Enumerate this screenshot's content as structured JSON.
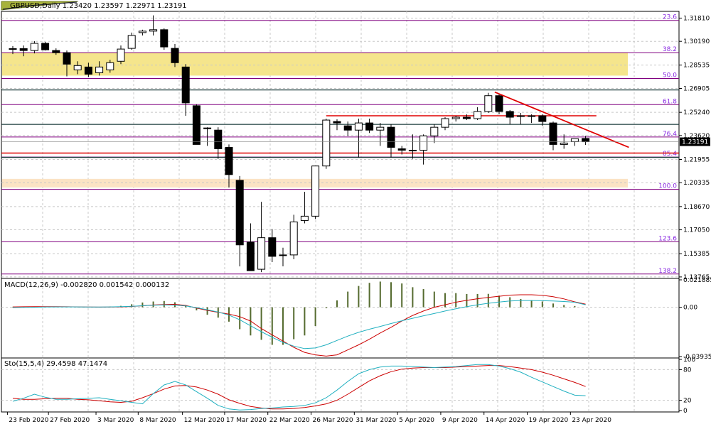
{
  "header": {
    "title": "GBPUSD,Daily",
    "ohlc": "1.23420 1.23597 1.22971 1.23191",
    "macd_label": "MACD(12,26,9) -0.002820 0.001542 0.000132",
    "stoch_label": "Sto(15,5,4) 29.4598 47.1474"
  },
  "colors": {
    "bull_fill": "#ffffff",
    "bear_fill": "#000000",
    "grid": "#c8c8c8",
    "fib_line": "#800080",
    "fib_text": "#8a2be2",
    "zone_yellow": "#f5e58c",
    "zone_peach": "#fbe3c4",
    "resistance": "#e00000",
    "level_dark": "#1f3f3f",
    "macd_hist": "#556b2f",
    "macd_signal": "#cc0000",
    "macd_main": "#20b0c0",
    "stoch_main": "#20b0c0",
    "stoch_signal": "#cc0000",
    "price_box": "#000000"
  },
  "chart_data": [
    {
      "type": "candlestick",
      "symbol": "GBPUSD",
      "timeframe": "Daily",
      "ylim": [
        1.1376,
        1.3218
      ],
      "y_ticks": [
        "1.31810",
        "1.30190",
        "1.28535",
        "1.26905",
        "1.25240",
        "1.23620",
        "1.21955",
        "1.20335",
        "1.18670",
        "1.17050",
        "1.15385",
        "1.13765"
      ],
      "current_price": "1.23191",
      "candles": [
        {
          "o": 1.2968,
          "h": 1.2986,
          "l": 1.293,
          "c": 1.2966
        },
        {
          "o": 1.2968,
          "h": 1.299,
          "l": 1.2915,
          "c": 1.2955
        },
        {
          "o": 1.2955,
          "h": 1.302,
          "l": 1.2935,
          "c": 1.3005
        },
        {
          "o": 1.3005,
          "h": 1.3015,
          "l": 1.2955,
          "c": 1.296
        },
        {
          "o": 1.2955,
          "h": 1.297,
          "l": 1.2925,
          "c": 1.294
        },
        {
          "o": 1.294,
          "h": 1.2955,
          "l": 1.2775,
          "c": 1.286
        },
        {
          "o": 1.282,
          "h": 1.288,
          "l": 1.279,
          "c": 1.285
        },
        {
          "o": 1.284,
          "h": 1.287,
          "l": 1.277,
          "c": 1.279
        },
        {
          "o": 1.28,
          "h": 1.288,
          "l": 1.278,
          "c": 1.284
        },
        {
          "o": 1.282,
          "h": 1.289,
          "l": 1.28,
          "c": 1.287
        },
        {
          "o": 1.288,
          "h": 1.299,
          "l": 1.286,
          "c": 1.2965
        },
        {
          "o": 1.297,
          "h": 1.308,
          "l": 1.296,
          "c": 1.306
        },
        {
          "o": 1.308,
          "h": 1.31,
          "l": 1.306,
          "c": 1.309
        },
        {
          "o": 1.309,
          "h": 1.32,
          "l": 1.306,
          "c": 1.31
        },
        {
          "o": 1.31,
          "h": 1.311,
          "l": 1.296,
          "c": 1.298
        },
        {
          "o": 1.297,
          "h": 1.3,
          "l": 1.284,
          "c": 1.287
        },
        {
          "o": 1.284,
          "h": 1.286,
          "l": 1.25,
          "c": 1.259
        },
        {
          "o": 1.257,
          "h": 1.258,
          "l": 1.23,
          "c": 1.23
        },
        {
          "o": 1.2415,
          "h": 1.242,
          "l": 1.229,
          "c": 1.241
        },
        {
          "o": 1.24,
          "h": 1.242,
          "l": 1.22,
          "c": 1.227
        },
        {
          "o": 1.228,
          "h": 1.23,
          "l": 1.2,
          "c": 1.209
        },
        {
          "o": 1.205,
          "h": 1.208,
          "l": 1.145,
          "c": 1.16
        },
        {
          "o": 1.162,
          "h": 1.175,
          "l": 1.142,
          "c": 1.142
        },
        {
          "o": 1.143,
          "h": 1.19,
          "l": 1.141,
          "c": 1.165
        },
        {
          "o": 1.165,
          "h": 1.171,
          "l": 1.148,
          "c": 1.152
        },
        {
          "o": 1.153,
          "h": 1.158,
          "l": 1.145,
          "c": 1.153
        },
        {
          "o": 1.153,
          "h": 1.181,
          "l": 1.15,
          "c": 1.176
        },
        {
          "o": 1.177,
          "h": 1.197,
          "l": 1.175,
          "c": 1.18
        },
        {
          "o": 1.18,
          "h": 1.204,
          "l": 1.178,
          "c": 1.215
        },
        {
          "o": 1.215,
          "h": 1.248,
          "l": 1.213,
          "c": 1.247
        },
        {
          "o": 1.246,
          "h": 1.2475,
          "l": 1.24,
          "c": 1.245
        },
        {
          "o": 1.243,
          "h": 1.246,
          "l": 1.236,
          "c": 1.24
        },
        {
          "o": 1.24,
          "h": 1.248,
          "l": 1.221,
          "c": 1.245
        },
        {
          "o": 1.245,
          "h": 1.248,
          "l": 1.238,
          "c": 1.24
        },
        {
          "o": 1.24,
          "h": 1.245,
          "l": 1.229,
          "c": 1.242
        },
        {
          "o": 1.242,
          "h": 1.244,
          "l": 1.221,
          "c": 1.228
        },
        {
          "o": 1.227,
          "h": 1.229,
          "l": 1.223,
          "c": 1.226
        },
        {
          "o": 1.226,
          "h": 1.237,
          "l": 1.22,
          "c": 1.226
        },
        {
          "o": 1.226,
          "h": 1.237,
          "l": 1.216,
          "c": 1.236
        },
        {
          "o": 1.236,
          "h": 1.244,
          "l": 1.231,
          "c": 1.242
        },
        {
          "o": 1.242,
          "h": 1.249,
          "l": 1.24,
          "c": 1.248
        },
        {
          "o": 1.248,
          "h": 1.25,
          "l": 1.246,
          "c": 1.249
        },
        {
          "o": 1.249,
          "h": 1.251,
          "l": 1.247,
          "c": 1.248
        },
        {
          "o": 1.248,
          "h": 1.256,
          "l": 1.247,
          "c": 1.253
        },
        {
          "o": 1.253,
          "h": 1.266,
          "l": 1.252,
          "c": 1.264
        },
        {
          "o": 1.264,
          "h": 1.265,
          "l": 1.251,
          "c": 1.253
        },
        {
          "o": 1.253,
          "h": 1.254,
          "l": 1.244,
          "c": 1.249
        },
        {
          "o": 1.25,
          "h": 1.252,
          "l": 1.244,
          "c": 1.25
        },
        {
          "o": 1.25,
          "h": 1.251,
          "l": 1.245,
          "c": 1.25
        },
        {
          "o": 1.25,
          "h": 1.251,
          "l": 1.243,
          "c": 1.246
        },
        {
          "o": 1.245,
          "h": 1.246,
          "l": 1.226,
          "c": 1.23
        },
        {
          "o": 1.23,
          "h": 1.237,
          "l": 1.227,
          "c": 1.231
        },
        {
          "o": 1.232,
          "h": 1.234,
          "l": 1.229,
          "c": 1.234
        },
        {
          "o": 1.2342,
          "h": 1.236,
          "l": 1.2297,
          "c": 1.2319
        }
      ],
      "fib_levels": [
        {
          "label": "23.6",
          "value": 1.3165
        },
        {
          "label": "38.2",
          "value": 1.294
        },
        {
          "label": "50.0",
          "value": 1.276
        },
        {
          "label": "61.8",
          "value": 1.2578
        },
        {
          "label": "76.4",
          "value": 1.2352
        },
        {
          "label": "85.4",
          "value": 1.2212
        },
        {
          "label": "100.0",
          "value": 1.1987
        },
        {
          "label": "123.6",
          "value": 1.1622
        },
        {
          "label": "138.2",
          "value": 1.1397
        }
      ],
      "zones": [
        {
          "from": 1.278,
          "to": 1.294,
          "color": "yellow"
        },
        {
          "from": 1.2,
          "to": 1.206,
          "color": "peach"
        }
      ],
      "horizontal_levels": [
        {
          "value": 1.268,
          "color": "dark"
        },
        {
          "value": 1.244,
          "color": "dark"
        },
        {
          "value": 1.224,
          "color": "red"
        },
        {
          "value": 1.221,
          "color": "dark"
        }
      ],
      "resistance_segment": {
        "from_index": 29,
        "to_index": 54,
        "value": 1.25
      },
      "trendline": {
        "start": {
          "index": 44.6,
          "value": 1.2665
        },
        "end": {
          "index": 57.0,
          "value": 1.228
        }
      }
    },
    {
      "type": "bar",
      "name": "MACD(12,26,9)",
      "ylim": [
        -0.039351,
        0.021885
      ],
      "y_ticks": [
        "0.021885",
        "0.00",
        "-0.039351"
      ],
      "histogram": [
        0.0004,
        0.0004,
        0.0006,
        0.0006,
        0.0005,
        0.0002,
        0.0002,
        0.0,
        0.0001,
        0.0006,
        0.0011,
        0.0024,
        0.0038,
        0.0046,
        0.005,
        0.004,
        0.0018,
        -0.0025,
        -0.006,
        -0.0083,
        -0.0115,
        -0.0175,
        -0.0225,
        -0.026,
        -0.03,
        -0.03,
        -0.0255,
        -0.0225,
        -0.015,
        -0.0008,
        0.0055,
        0.0125,
        0.017,
        0.0195,
        0.0205,
        0.02,
        0.019,
        0.016,
        0.0145,
        0.0125,
        0.0113,
        0.0113,
        0.0106,
        0.0106,
        0.0107,
        0.0093,
        0.008,
        0.0066,
        0.0056,
        0.0046,
        0.003,
        0.0018,
        0.001,
        0.0
      ],
      "signal_line": [
        0.0003,
        0.0004,
        0.0005,
        0.0005,
        0.0005,
        0.0004,
        0.0003,
        0.0002,
        0.0001,
        0.0002,
        0.0003,
        0.0006,
        0.0012,
        0.0018,
        0.0022,
        0.0023,
        0.0015,
        -0.0007,
        -0.0025,
        -0.004,
        -0.0055,
        -0.0075,
        -0.011,
        -0.017,
        -0.022,
        -0.027,
        -0.032,
        -0.036,
        -0.038,
        -0.039,
        -0.038,
        -0.034,
        -0.03,
        -0.0255,
        -0.0205,
        -0.016,
        -0.011,
        -0.0065,
        -0.003,
        0.0,
        0.002,
        0.004,
        0.0055,
        0.0068,
        0.0078,
        0.0088,
        0.0097,
        0.01,
        0.01,
        0.0095,
        0.0084,
        0.0067,
        0.0043,
        0.0025
      ],
      "main_line": [
        -0.0002,
        -0.0001,
        0.0,
        0.0002,
        0.0003,
        0.0003,
        0.0003,
        0.0002,
        0.0002,
        0.0003,
        0.0005,
        0.0008,
        0.0012,
        0.0016,
        0.0019,
        0.0017,
        0.001,
        -0.0003,
        -0.002,
        -0.0038,
        -0.0063,
        -0.01,
        -0.0148,
        -0.0195,
        -0.024,
        -0.028,
        -0.031,
        -0.033,
        -0.0325,
        -0.03,
        -0.0265,
        -0.023,
        -0.02,
        -0.0175,
        -0.0153,
        -0.013,
        -0.0108,
        -0.0088,
        -0.0068,
        -0.005,
        -0.003,
        -0.0012,
        0.0005,
        0.002,
        0.0032,
        0.0042,
        0.005,
        0.0054,
        0.0054,
        0.0052,
        0.005,
        0.0046,
        0.004,
        0.002
      ]
    },
    {
      "type": "line",
      "name": "Sto(15,5,4)",
      "ylim": [
        0,
        100
      ],
      "y_ticks": [
        "100",
        "80",
        "20",
        "0"
      ],
      "main_line": [
        18,
        24,
        32,
        26,
        22,
        22,
        23,
        24,
        25,
        22,
        19,
        16,
        13,
        33,
        50,
        57,
        50,
        37,
        24,
        10,
        3,
        1,
        2,
        4,
        5,
        7,
        8,
        10,
        15,
        25,
        40,
        57,
        72,
        80,
        85,
        87,
        87,
        86,
        85,
        84,
        85,
        86,
        88,
        90,
        90,
        87,
        82,
        75,
        65,
        56,
        47,
        38,
        30,
        29
      ],
      "signal_line": [
        24,
        22,
        22,
        23,
        24,
        24,
        22,
        21,
        19,
        17,
        16,
        18,
        25,
        33,
        42,
        48,
        49,
        46,
        40,
        32,
        21,
        14,
        8,
        5,
        3,
        3,
        4,
        6,
        9,
        13,
        20,
        32,
        45,
        58,
        68,
        76,
        81,
        83,
        84,
        84,
        84,
        85,
        86,
        87,
        88,
        88,
        86,
        83,
        80,
        75,
        69,
        62,
        55,
        47
      ]
    }
  ],
  "x_axis": {
    "labels": [
      {
        "text": "23 Feb 2020",
        "index": -0.5
      },
      {
        "text": "27 Feb 2020",
        "index": 3.3
      },
      {
        "text": "3 Mar 2020",
        "index": 7.7
      },
      {
        "text": "8 Mar 2020",
        "index": 11.6
      },
      {
        "text": "12 Mar 2020",
        "index": 15.7
      },
      {
        "text": "17 Mar 2020",
        "index": 19.6
      },
      {
        "text": "22 Mar 2020",
        "index": 23.6
      },
      {
        "text": "26 Mar 2020",
        "index": 27.6
      },
      {
        "text": "31 Mar 2020",
        "index": 31.6
      },
      {
        "text": "5 Apr 2020",
        "index": 35.6
      },
      {
        "text": "9 Apr 2020",
        "index": 39.6
      },
      {
        "text": "14 Apr 2020",
        "index": 43.6
      },
      {
        "text": "19 Apr 2020",
        "index": 47.6
      },
      {
        "text": "23 Apr 2020",
        "index": 51.6
      }
    ]
  }
}
